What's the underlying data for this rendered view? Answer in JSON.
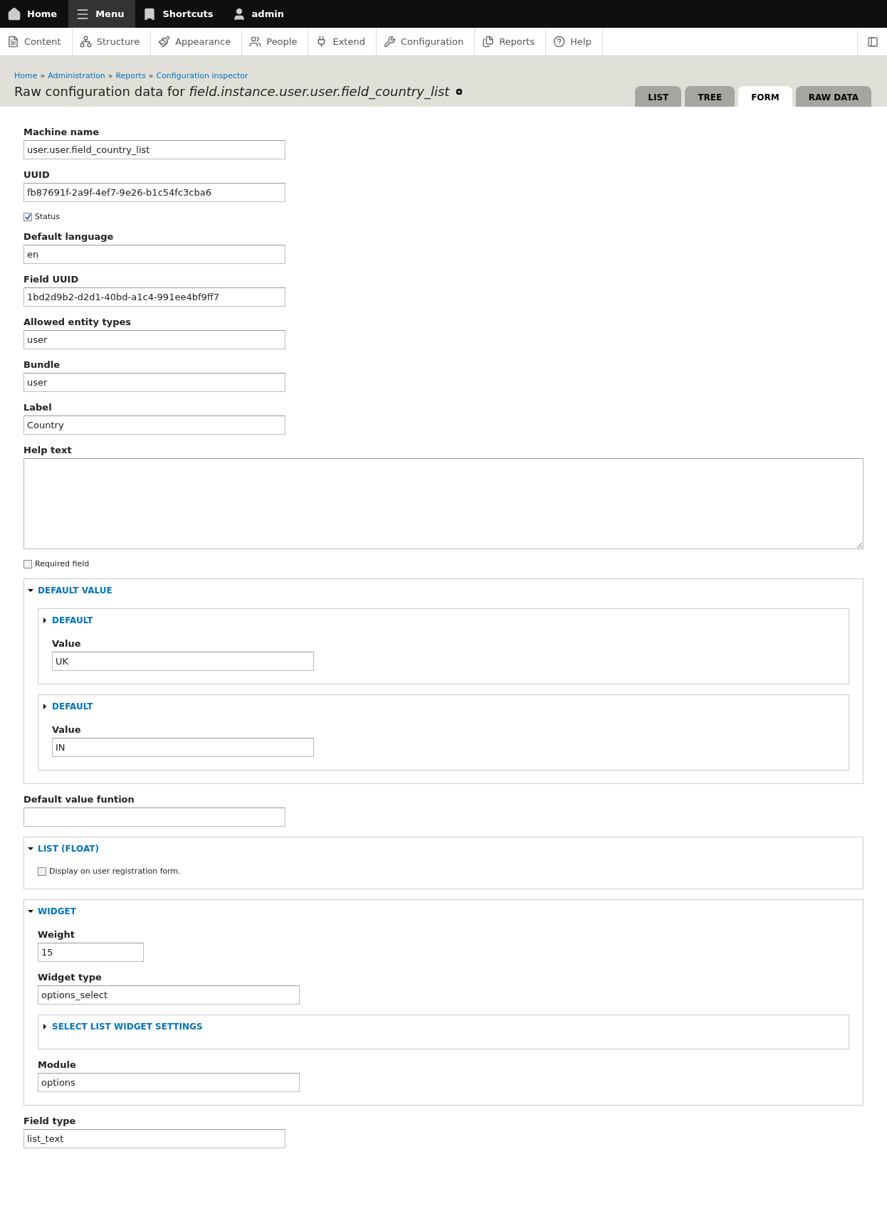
{
  "top_bar": {
    "items": [
      {
        "kind": "home",
        "label": "Home",
        "selected": false
      },
      {
        "kind": "menu",
        "label": "Menu",
        "selected": true
      },
      {
        "kind": "shortcuts",
        "label": "Shortcuts",
        "selected": false
      },
      {
        "kind": "user",
        "label": "admin",
        "selected": false
      }
    ]
  },
  "admin_menu": {
    "items": [
      {
        "kind": "content",
        "label": "Content"
      },
      {
        "kind": "structure",
        "label": "Structure"
      },
      {
        "kind": "appearance",
        "label": "Appearance"
      },
      {
        "kind": "people",
        "label": "People"
      },
      {
        "kind": "extend",
        "label": "Extend"
      },
      {
        "kind": "configuration",
        "label": "Configuration"
      },
      {
        "kind": "reports",
        "label": "Reports"
      },
      {
        "kind": "help",
        "label": "Help"
      }
    ]
  },
  "breadcrumb": {
    "separator": "»",
    "links": [
      "Home",
      "Administration",
      "Reports",
      "Configuration inspector"
    ]
  },
  "page_title": "Raw configuration data for *field.instance.user.user.field_country_list*",
  "tabs": [
    {
      "label": "LIST",
      "selected": false
    },
    {
      "label": "TREE",
      "selected": false
    },
    {
      "label": "FORM",
      "selected": true
    },
    {
      "label": "RAW DATA",
      "selected": false
    }
  ],
  "form": [
    {
      "kind": "text",
      "label": "Machine name",
      "value": "user.user.field_country_list"
    },
    {
      "kind": "text",
      "label": "UUID",
      "value": "fb87691f-2a9f-4ef7-9e26-b1c54fc3cba6"
    },
    {
      "kind": "checkbox",
      "label": "Status",
      "checked": true
    },
    {
      "kind": "text",
      "label": "Default language",
      "value": "en"
    },
    {
      "kind": "text",
      "label": "Field UUID",
      "value": "1bd2d9b2-d2d1-40bd-a1c4-991ee4bf9ff7"
    },
    {
      "kind": "text",
      "label": "Allowed entity types",
      "value": "user"
    },
    {
      "kind": "text",
      "label": "Bundle",
      "value": "user"
    },
    {
      "kind": "text",
      "label": "Label",
      "value": "Country"
    },
    {
      "kind": "textarea",
      "label": "Help text"
    },
    {
      "kind": "checkbox",
      "label": "Required field",
      "checked": false
    },
    {
      "kind": "fieldset",
      "title": "DEFAULT VALUE",
      "expanded": true,
      "children": [
        {
          "kind": "fieldset",
          "title": "DEFAULT",
          "expanded": false,
          "children": [
            {
              "kind": "text",
              "label": "Value",
              "value": "UK"
            }
          ]
        },
        {
          "kind": "fieldset",
          "title": "DEFAULT",
          "expanded": false,
          "children": [
            {
              "kind": "text",
              "label": "Value",
              "value": "IN"
            }
          ]
        }
      ]
    },
    {
      "kind": "text",
      "label": "Default value funtion"
    },
    {
      "kind": "fieldset",
      "title": "LIST (FLOAT)",
      "expanded": true,
      "children": [
        {
          "kind": "checkbox",
          "label": "Display on user registration form.",
          "checked": false
        }
      ]
    },
    {
      "kind": "fieldset",
      "title": "WIDGET",
      "expanded": true,
      "children": [
        {
          "kind": "number",
          "label": "Weight",
          "value": "15"
        },
        {
          "kind": "text",
          "label": "Widget type",
          "value": "options_select"
        },
        {
          "kind": "fieldset",
          "title": "SELECT LIST WIDGET SETTINGS",
          "expanded": false
        },
        {
          "kind": "text",
          "label": "Module",
          "value": "options"
        }
      ]
    },
    {
      "kind": "text",
      "label": "Field type",
      "value": "list_text"
    }
  ]
}
